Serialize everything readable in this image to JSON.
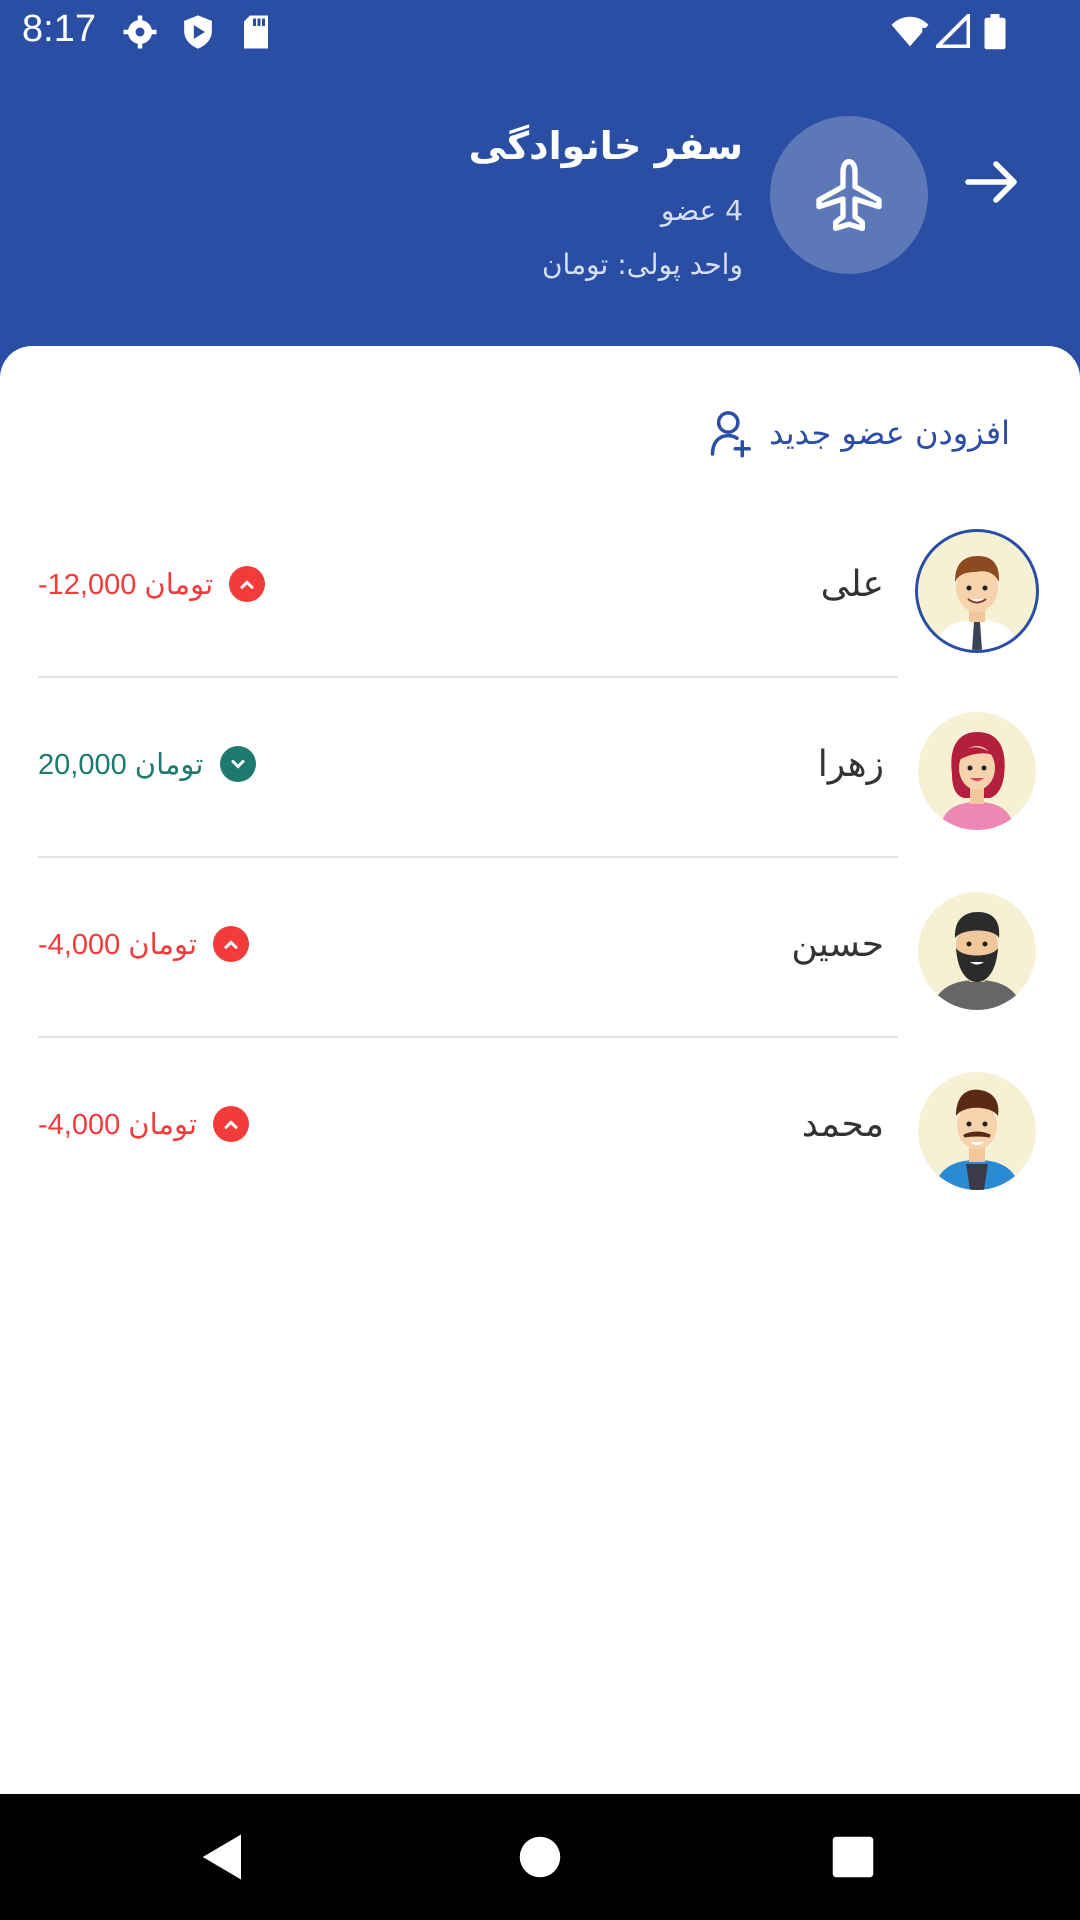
{
  "status_bar": {
    "time": "8:17",
    "icons": [
      "settings-icon",
      "shield-play-icon",
      "sd-card-icon",
      "wifi-alert-icon",
      "signal-icon",
      "battery-icon"
    ]
  },
  "header": {
    "title": "سفر خانوادگی",
    "members": "4 عضو",
    "currency": "واحد پولی: تومان",
    "icon": "airplane-icon"
  },
  "add_member": {
    "label": "افزودن عضو جدید",
    "icon": "add-user-icon"
  },
  "members": [
    {
      "name": "علی",
      "balance": "-12,000 تومان",
      "direction": "up",
      "color": "#f23b3b",
      "avatar": "man-with-tie"
    },
    {
      "name": "زهرا",
      "balance": "20,000 تومان",
      "direction": "down",
      "color": "#1e7a70",
      "avatar": "woman-red-hair"
    },
    {
      "name": "حسین",
      "balance": "-4,000 تومان",
      "direction": "up",
      "color": "#f23b3b",
      "avatar": "bearded-man"
    },
    {
      "name": "محمد",
      "balance": "-4,000 تومان",
      "direction": "up",
      "color": "#f23b3b",
      "avatar": "man-blue-jacket"
    }
  ],
  "colors": {
    "primary": "#2a4ea4",
    "negative": "#f23b3b",
    "positive": "#1e7a70"
  },
  "nav": [
    "back-icon",
    "home-icon",
    "recents-icon"
  ]
}
